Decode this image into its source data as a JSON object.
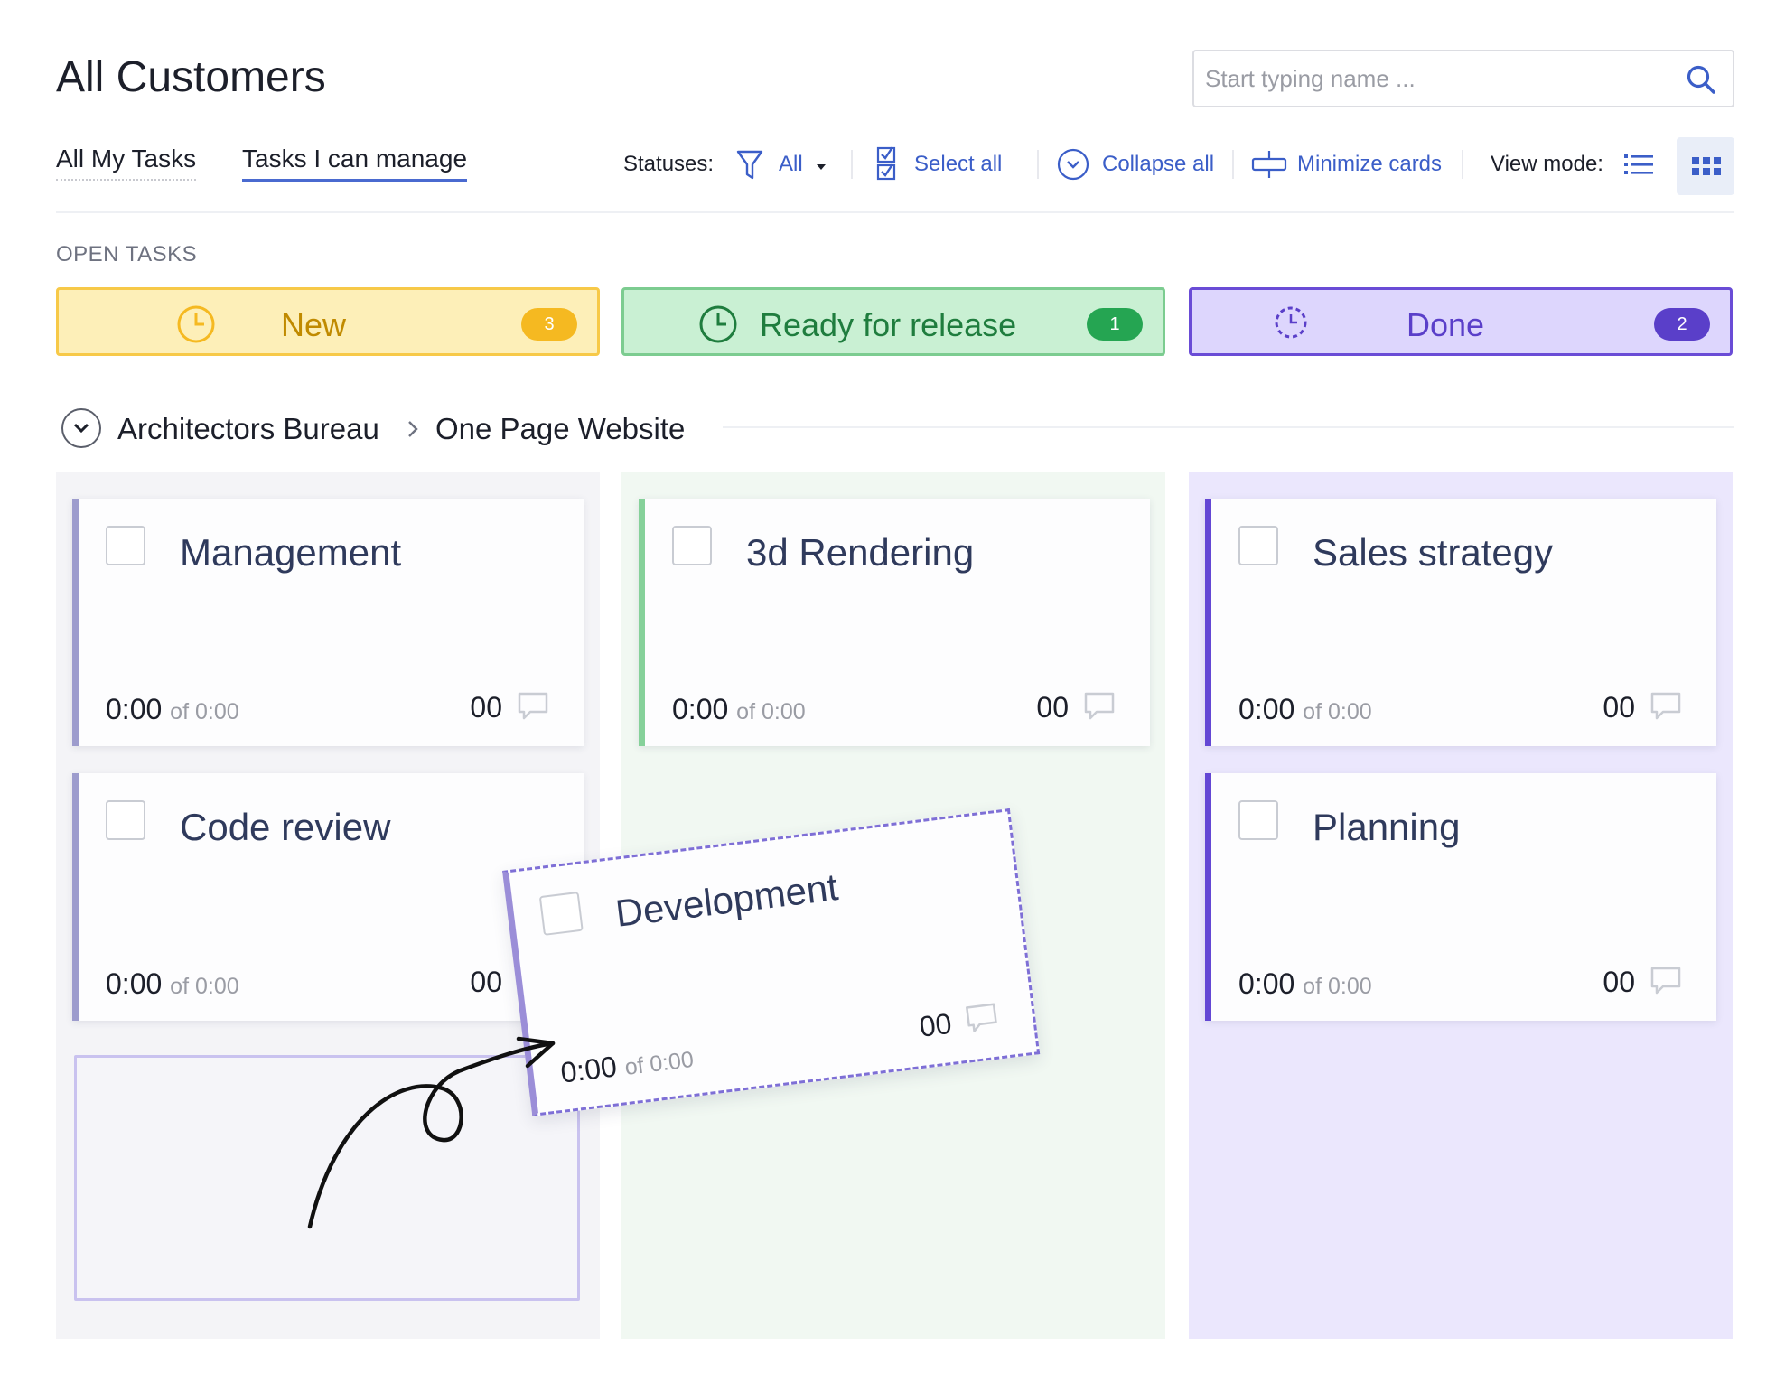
{
  "page_title": "All Customers",
  "search": {
    "placeholder": "Start typing name ...",
    "icon": "search-icon"
  },
  "tabs": [
    {
      "label": "All My Tasks",
      "active": false
    },
    {
      "label": "Tasks I can manage",
      "active": true
    }
  ],
  "toolbar": {
    "statuses_label": "Statuses:",
    "statuses_value": "All",
    "select_all": "Select all",
    "collapse_all": "Collapse all",
    "minimize_cards": "Minimize cards",
    "view_mode_label": "View mode:",
    "active_view": "grid",
    "link_color": "#3b5ec8"
  },
  "section_label": "OPEN TASKS",
  "statuses": [
    {
      "label": "New",
      "count": "3",
      "bg": "#fdefb8",
      "border": "#f7c948",
      "text": "#c08a00",
      "badge": "#f5b921",
      "icon": "clock-icon"
    },
    {
      "label": "Ready for release",
      "count": "1",
      "bg": "#c9f0d3",
      "border": "#7ccc90",
      "text": "#1f7d3e",
      "badge": "#25a552",
      "icon": "clock-icon"
    },
    {
      "label": "Done",
      "count": "2",
      "bg": "#ddd6fd",
      "border": "#6a4cd6",
      "text": "#5a3fc9",
      "badge": "#5a3fc9",
      "icon": "dashed-clock-icon"
    }
  ],
  "breadcrumb": {
    "client": "Architectors Bureau",
    "project": "One Page Website"
  },
  "columns": [
    {
      "status": "New",
      "bg": "#f4f4f7",
      "accent": "#9d9ccd",
      "cards": [
        {
          "title": "Management",
          "time": "0:00",
          "of": "of 0:00",
          "count": "00"
        },
        {
          "title": "Code review",
          "time": "0:00",
          "of": "of 0:00",
          "count": "00"
        }
      ]
    },
    {
      "status": "Ready for release",
      "bg": "#f1f8f2",
      "accent": "#86d19a",
      "cards": [
        {
          "title": "3d Rendering",
          "time": "0:00",
          "of": "of 0:00",
          "count": "00"
        }
      ]
    },
    {
      "status": "Done",
      "bg": "#ebe7fd",
      "accent": "#6347d4",
      "cards": [
        {
          "title": "Sales strategy",
          "time": "0:00",
          "of": "of 0:00",
          "count": "00"
        },
        {
          "title": "Planning",
          "time": "0:00",
          "of": "of 0:00",
          "count": "00"
        }
      ]
    }
  ],
  "dragging_card": {
    "title": "Development",
    "time": "0:00",
    "of": "of 0:00",
    "count": "00"
  }
}
